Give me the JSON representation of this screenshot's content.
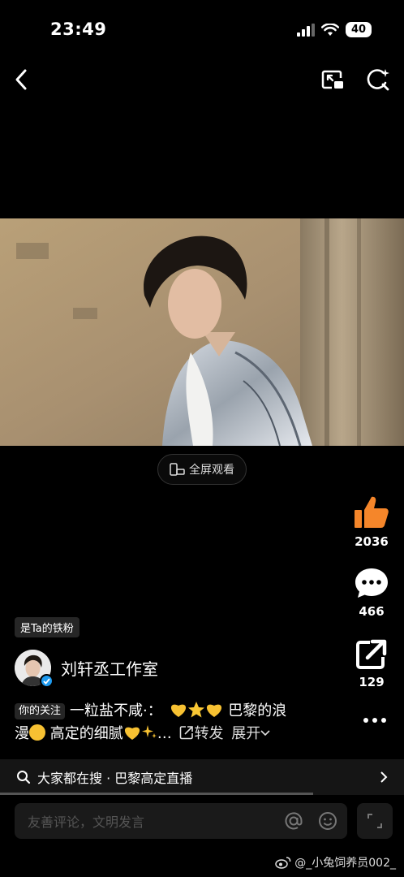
{
  "status_bar": {
    "time": "23:49",
    "battery": "40"
  },
  "nav": {
    "back_icon": "chevron-left-icon",
    "pip_icon": "picture-in-picture-icon",
    "search_icon": "search-sparkle-icon"
  },
  "video": {
    "fullscreen_label": "全屏观看"
  },
  "actions": {
    "like_count": "2036",
    "comment_count": "466",
    "share_count": "129"
  },
  "author": {
    "fan_badge": "是Ta的铁粉",
    "name": "刘轩丞工作室"
  },
  "caption": {
    "follow_badge": "你的关注",
    "line1": "一粒盐不咸·：",
    "line1_tail": "巴黎的浪",
    "line2a": "漫",
    "line2b": "高定的细腻",
    "line2_ellipsis": "…",
    "repost_label": "转发",
    "expand_label": "展开"
  },
  "search": {
    "text": "大家都在搜 · 巴黎高定直播"
  },
  "comment": {
    "placeholder": "友善评论，文明发言"
  },
  "watermark": {
    "text": "@_小兔饲养员002_"
  },
  "colors": {
    "like_orange": "#f5862a",
    "heart_yellow": "#f7c132",
    "verify_blue": "#1e9bf0"
  }
}
